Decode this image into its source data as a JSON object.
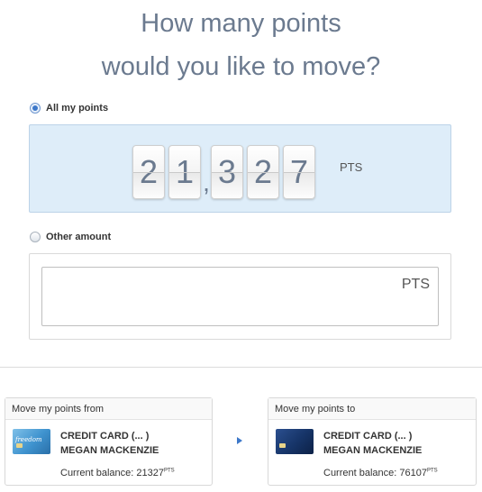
{
  "headline": {
    "line1": "How many points",
    "line2": "would you like to move?"
  },
  "options": {
    "all_label": "All my points",
    "other_label": "Other amount",
    "selected": "all"
  },
  "points_display": {
    "digits": [
      "2",
      "1",
      "3",
      "2",
      "7"
    ],
    "separator": ",",
    "unit": "PTS"
  },
  "other_amount": {
    "value": "",
    "unit": "PTS"
  },
  "from_card": {
    "title": "Move my points from",
    "card_name": "CREDIT CARD (...        )",
    "holder": "MEGAN MACKENZIE",
    "balance_label": "Current balance: 21327",
    "balance_unit": "PTS",
    "card_image": "freedom-card-icon",
    "brand_text": "freedom"
  },
  "to_card": {
    "title": "Move my points to",
    "card_name": "CREDIT CARD (...        )",
    "holder": "MEGAN MACKENZIE",
    "balance_label": "Current balance: 76107",
    "balance_unit": "PTS",
    "card_image": "sapphire-card-icon"
  },
  "colors": {
    "accent": "#3d78c9",
    "panel_bg": "#deedf9",
    "headline": "#6b7a8f"
  }
}
